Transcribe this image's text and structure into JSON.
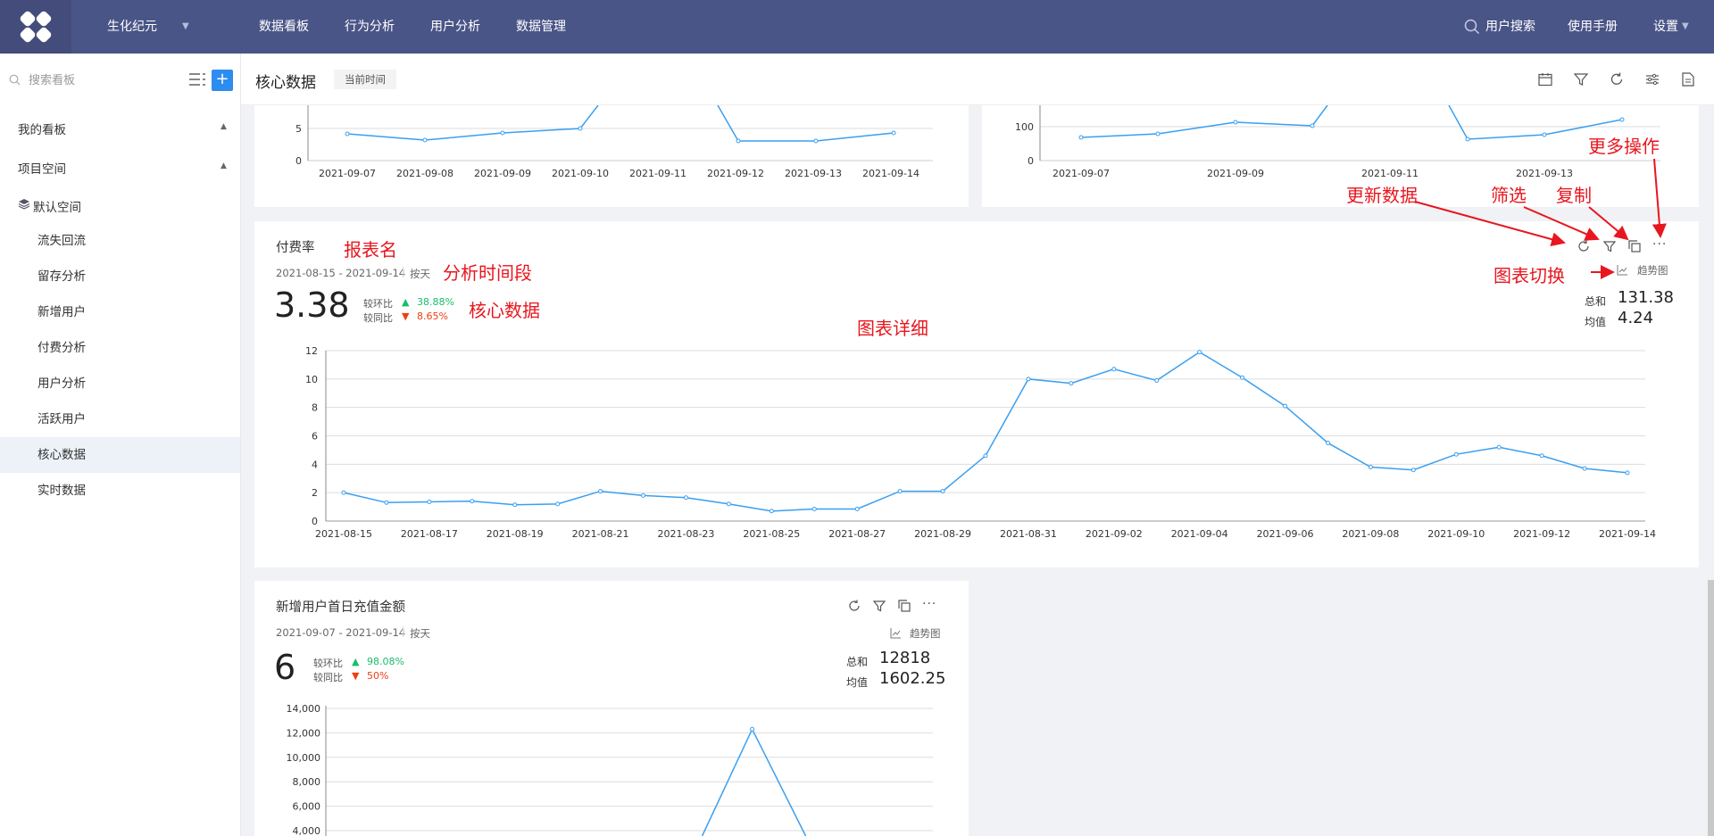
{
  "header": {
    "project": "生化纪元",
    "nav": [
      "数据看板",
      "行为分析",
      "用户分析",
      "数据管理"
    ],
    "user_search": "用户搜索",
    "manual": "使用手册",
    "settings": "设置"
  },
  "sidebar": {
    "search_placeholder": "搜索看板",
    "add_label": "+",
    "my_boards": "我的看板",
    "project_space": "项目空间",
    "default_space": "默认空间",
    "items": [
      "流失回流",
      "留存分析",
      "新增用户",
      "付费分析",
      "用户分析",
      "活跃用户",
      "核心数据",
      "实时数据"
    ],
    "active_item": "核心数据"
  },
  "subbar": {
    "title": "核心数据",
    "time_tag": "当前时间"
  },
  "top_left_chart": {
    "x": [
      "2021-09-07",
      "2021-09-08",
      "2021-09-09",
      "2021-09-10",
      "2021-09-11",
      "2021-09-12",
      "2021-09-13",
      "2021-09-14"
    ],
    "y_ticks": [
      "5",
      "0"
    ]
  },
  "top_right_chart": {
    "x": [
      "2021-09-07",
      "2021-09-09",
      "2021-09-11",
      "2021-09-13"
    ],
    "y_ticks": [
      "100",
      "0"
    ]
  },
  "card_pay": {
    "title": "付费率",
    "range": "2021-08-15 - 2021-09-14",
    "granularity": "按天",
    "value": "3.38",
    "mom_label": "较环比",
    "mom_value": "38.88%",
    "yoy_label": "较同比",
    "yoy_value": "8.65%",
    "trend_label": "趋势图",
    "total_label": "总和",
    "total_value": "131.38",
    "avg_label": "均值",
    "avg_value": "4.24"
  },
  "card_recharge": {
    "title": "新增用户首日充值金额",
    "range": "2021-09-07 - 2021-09-14",
    "granularity": "按天",
    "value": "6",
    "mom_label": "较环比",
    "mom_value": "98.08%",
    "yoy_label": "较同比",
    "yoy_value": "50%",
    "trend_label": "趋势图",
    "total_label": "总和",
    "total_value": "12818",
    "avg_label": "均值",
    "avg_value": "1602.25"
  },
  "annotations": {
    "report_name": "报表名",
    "time_range": "分析时间段",
    "core_data": "核心数据",
    "chart_detail": "图表详细",
    "refresh": "更新数据",
    "filter": "筛选",
    "copy": "复制",
    "more": "更多操作",
    "switch": "图表切换"
  },
  "colors": {
    "header": "#4a5587",
    "line": "#3a9ff0",
    "up": "#19be6b",
    "down": "#ed4014",
    "annotation": "#e8161e"
  },
  "chart_data": [
    {
      "type": "line",
      "x": [
        "2021-08-15",
        "2021-08-16",
        "2021-08-17",
        "2021-08-18",
        "2021-08-19",
        "2021-08-20",
        "2021-08-21",
        "2021-08-22",
        "2021-08-23",
        "2021-08-24",
        "2021-08-25",
        "2021-08-26",
        "2021-08-27",
        "2021-08-28",
        "2021-08-29",
        "2021-08-30",
        "2021-08-31",
        "2021-09-01",
        "2021-09-02",
        "2021-09-03",
        "2021-09-04",
        "2021-09-05",
        "2021-09-06",
        "2021-09-07",
        "2021-09-08",
        "2021-09-09",
        "2021-09-10",
        "2021-09-11",
        "2021-09-12",
        "2021-09-13",
        "2021-09-14"
      ],
      "values": [
        2.0,
        1.3,
        1.35,
        1.4,
        1.15,
        1.2,
        2.1,
        1.8,
        1.65,
        1.2,
        0.7,
        0.85,
        0.85,
        2.1,
        2.1,
        4.6,
        10.0,
        9.7,
        10.7,
        9.9,
        11.9,
        10.1,
        8.1,
        5.5,
        3.8,
        3.6,
        4.7,
        5.2,
        4.6,
        3.7,
        3.4
      ],
      "x_tick_labels": [
        "2021-08-15",
        "2021-08-17",
        "2021-08-19",
        "2021-08-21",
        "2021-08-23",
        "2021-08-25",
        "2021-08-27",
        "2021-08-29",
        "2021-08-31",
        "2021-09-02",
        "2021-09-04",
        "2021-09-06",
        "2021-09-08",
        "2021-09-10",
        "2021-09-12",
        "2021-09-14"
      ],
      "y_ticks": [
        "0",
        "2",
        "4",
        "6",
        "8",
        "10",
        "12"
      ],
      "ylim": [
        0,
        12
      ]
    },
    {
      "type": "line",
      "y_ticks": [
        "4,000",
        "6,000",
        "8,000",
        "10,000",
        "12,000",
        "14,000"
      ],
      "ylim": [
        0,
        14000
      ],
      "x_count": 8,
      "values": [
        null,
        null,
        null,
        null,
        null,
        12300,
        null,
        null
      ]
    }
  ]
}
